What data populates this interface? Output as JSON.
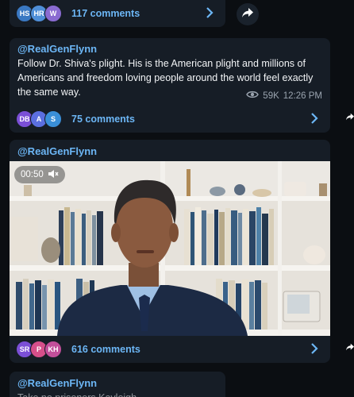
{
  "posts": [
    {
      "comments_label": "117 comments",
      "avatars": [
        {
          "initials": "HS",
          "color": "#3a78c2"
        },
        {
          "initials": "HR",
          "color": "#4f8fd8"
        },
        {
          "initials": "W",
          "color": "#8a6bd1"
        }
      ]
    },
    {
      "author": "@RealGenFlynn",
      "text": "Follow Dr. Shiva's plight. His is the American plight and millions of Americans and freedom loving people around the world feel exactly the same way.",
      "views": "59K",
      "time": "12:26 PM",
      "comments_label": "75 comments",
      "avatars": [
        {
          "initials": "DB",
          "color": "#7b4fd6"
        },
        {
          "initials": "A",
          "color": "#5b6fe0"
        },
        {
          "initials": "S",
          "color": "#3a8fd8"
        }
      ]
    },
    {
      "author": "@RealGenFlynn",
      "video_time": "00:50",
      "comments_label": "616 comments",
      "avatars": [
        {
          "initials": "SR",
          "color": "#7b4fd6"
        },
        {
          "initials": "P",
          "color": "#d64f8a"
        },
        {
          "initials": "KH",
          "color": "#c24f9a"
        }
      ]
    },
    {
      "author": "@RealGenFlynn",
      "text": "Take no prisoners Kayleigh"
    }
  ],
  "colors": {
    "background": "#0b0e12",
    "card": "#161d26",
    "accent": "#6cb6f5"
  }
}
